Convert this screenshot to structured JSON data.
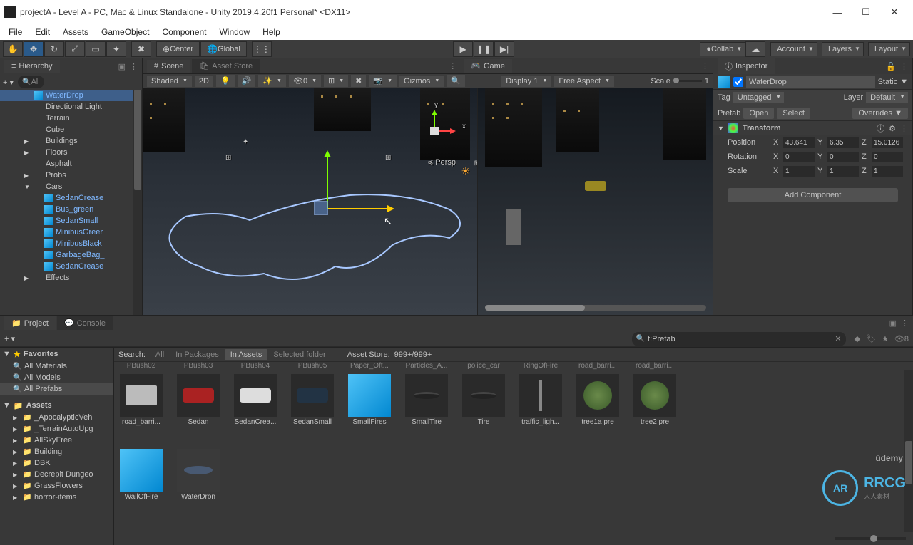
{
  "window": {
    "title": "projectA - Level A - PC, Mac & Linux Standalone - Unity 2019.4.20f1 Personal* <DX11>"
  },
  "menubar": [
    "File",
    "Edit",
    "Assets",
    "GameObject",
    "Component",
    "Window",
    "Help"
  ],
  "toolbar": {
    "pivot": "Center",
    "handle": "Global",
    "collab": "Collab",
    "account": "Account",
    "layers": "Layers",
    "layout": "Layout"
  },
  "hierarchy": {
    "title": "Hierarchy",
    "search_placeholder": "All",
    "items": [
      {
        "name": "WaterDrop",
        "prefab": true,
        "depth": 2,
        "sel": true
      },
      {
        "name": "Directional Light",
        "prefab": false,
        "depth": 2
      },
      {
        "name": "Terrain",
        "prefab": false,
        "depth": 2
      },
      {
        "name": "Cube",
        "prefab": false,
        "depth": 2
      },
      {
        "name": "Buildings",
        "prefab": false,
        "depth": 2,
        "arr": "▶"
      },
      {
        "name": "Floors",
        "prefab": false,
        "depth": 2,
        "arr": "▶"
      },
      {
        "name": "Asphalt",
        "prefab": false,
        "depth": 2
      },
      {
        "name": "Probs",
        "prefab": false,
        "depth": 2,
        "arr": "▶"
      },
      {
        "name": "Cars",
        "prefab": false,
        "depth": 2,
        "arr": "▼"
      },
      {
        "name": "SedanCrease",
        "prefab": true,
        "depth": 3,
        "ch": "›"
      },
      {
        "name": "Bus_green",
        "prefab": true,
        "depth": 3,
        "ch": "›"
      },
      {
        "name": "SedanSmall",
        "prefab": true,
        "depth": 3
      },
      {
        "name": "MinibusGreer",
        "prefab": true,
        "depth": 3,
        "ch": "›"
      },
      {
        "name": "MinibusBlack",
        "prefab": true,
        "depth": 3,
        "ch": "›"
      },
      {
        "name": "GarbageBag_",
        "prefab": true,
        "depth": 3,
        "ch": "›"
      },
      {
        "name": "SedanCrease",
        "prefab": true,
        "depth": 3,
        "ch": "›"
      },
      {
        "name": "Effects",
        "prefab": false,
        "depth": 2,
        "arr": "▶"
      }
    ]
  },
  "scene": {
    "tab_scene": "Scene",
    "tab_asset": "Asset Store",
    "shading": "Shaded",
    "mode2d": "2D",
    "gizmos": "Gizmos",
    "axis_y": "y",
    "axis_x": "x",
    "persp": "Persp"
  },
  "game": {
    "tab": "Game",
    "display": "Display 1",
    "aspect": "Free Aspect",
    "scale": "Scale",
    "scale_val": "1"
  },
  "inspector": {
    "title": "Inspector",
    "object_name": "WaterDrop",
    "static": "Static",
    "tag_label": "Tag",
    "tag_value": "Untagged",
    "layer_label": "Layer",
    "layer_value": "Default",
    "prefab_label": "Prefab",
    "open": "Open",
    "select": "Select",
    "overrides": "Overrides",
    "transform": "Transform",
    "position": "Position",
    "pos_x": "43.641",
    "pos_y": "6.35",
    "pos_z": "15.0126",
    "rotation": "Rotation",
    "rot_x": "0",
    "rot_y": "0",
    "rot_z": "0",
    "scale": "Scale",
    "scl_x": "1",
    "scl_y": "1",
    "scl_z": "1",
    "add_component": "Add Component"
  },
  "project": {
    "tab_project": "Project",
    "tab_console": "Console",
    "search_query": "t:Prefab",
    "hidden_count": "8",
    "filter_label": "Search:",
    "filters": [
      "All",
      "In Packages",
      "In Assets",
      "Selected folder"
    ],
    "filter_active_index": 2,
    "asset_store_label": "Asset Store:",
    "asset_store_value": "999+/999+",
    "favorites": "Favorites",
    "fav_items": [
      "All Materials",
      "All Models",
      "All Prefabs"
    ],
    "fav_sel_index": 2,
    "assets": "Assets",
    "folders": [
      "_ApocalypticVeh",
      "_TerrainAutoUpg",
      "AllSkyFree",
      "Building",
      "DBK",
      "Decrepit Dungeo",
      "GrassFlowers",
      "horror-items"
    ],
    "row_labels": [
      "PBush02",
      "PBush03",
      "PBush04",
      "PBush05",
      "Paper_Oft...",
      "Particles_A...",
      "police_car",
      "RingOfFire",
      "road_barri...",
      "road_barri..."
    ],
    "grid": [
      {
        "name": "road_barri...",
        "kind": "barrier"
      },
      {
        "name": "Sedan",
        "kind": "car-red"
      },
      {
        "name": "SedanCrea...",
        "kind": "car-white"
      },
      {
        "name": "SedanSmall",
        "kind": "car-dark"
      },
      {
        "name": "SmallFires",
        "kind": "cube"
      },
      {
        "name": "SmallTire",
        "kind": "tire"
      },
      {
        "name": "Tire",
        "kind": "tire"
      },
      {
        "name": "traffic_ligh...",
        "kind": "light"
      },
      {
        "name": "tree1a pre",
        "kind": "tree"
      },
      {
        "name": "tree2 pre",
        "kind": "tree"
      }
    ],
    "grid2": [
      {
        "name": "WallOfFire",
        "kind": "cube"
      },
      {
        "name": "WaterDron",
        "kind": "water"
      }
    ]
  },
  "watermark": {
    "brand": "RRCG",
    "sub": "人人素材",
    "udemy": "ūdemy"
  }
}
